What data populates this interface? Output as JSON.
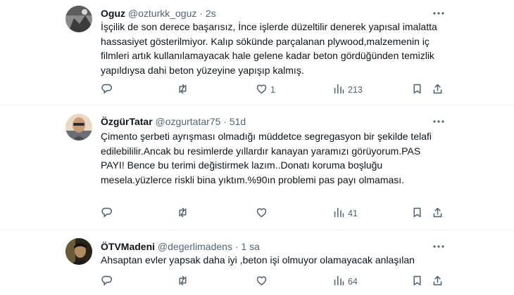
{
  "tweets": [
    {
      "name": "Oguz",
      "handle": "@ozturkk_oguz",
      "sep": "·",
      "time": "2s",
      "text": "İşçilik de son derece başarısız, İnce işlerde düzeltilir denerek yapısal imalatta hassasiyet gösterilmiyor. Kalıp sökünde parçalanan plywood,malzemenin iç filmleri artık kullanılamayacak hale gelene kadar beton gördüğünden temizlik yapıldıysa dahi beton yüzeyine yapışıp kalmış.",
      "replies": "",
      "retweets": "",
      "likes": "1",
      "views": "213"
    },
    {
      "name": "ÖzgürTatar",
      "handle": "@ozgurtatar75",
      "sep": "·",
      "time": "51d",
      "text": "Çimento şerbeti ayrışması olmadığı müddetce segregasyon bir şekilde telafi edilebililir.Ancak bu resimlerde yıllardır kanayan yaramızı görüyorum.PAS PAYI! Bence bu terimi değistirmek lazım..Donatı koruma boşluğu mesela.yüzlerce riskli bina yıktım.%90ın problemi pas payı olmaması.",
      "replies": "",
      "retweets": "",
      "likes": "",
      "views": "41"
    },
    {
      "name": "ÖTVMadeni",
      "handle": "@degerlimadens",
      "sep": "·",
      "time": "1 sa",
      "text": "Ahsaptan evler yapsak daha iyi ,beton işi olmuyor olamayacak anlaşılan",
      "replies": "",
      "retweets": "",
      "likes": "",
      "views": "64"
    }
  ],
  "icons": {
    "reply": "reply-icon",
    "retweet": "retweet-icon",
    "like": "heart-icon",
    "views": "views-icon",
    "bookmark": "bookmark-icon",
    "share": "share-icon",
    "more": "more-icon"
  },
  "colors": {
    "text": "#0f1419",
    "secondary": "#536471",
    "divider": "#eff3f4"
  }
}
